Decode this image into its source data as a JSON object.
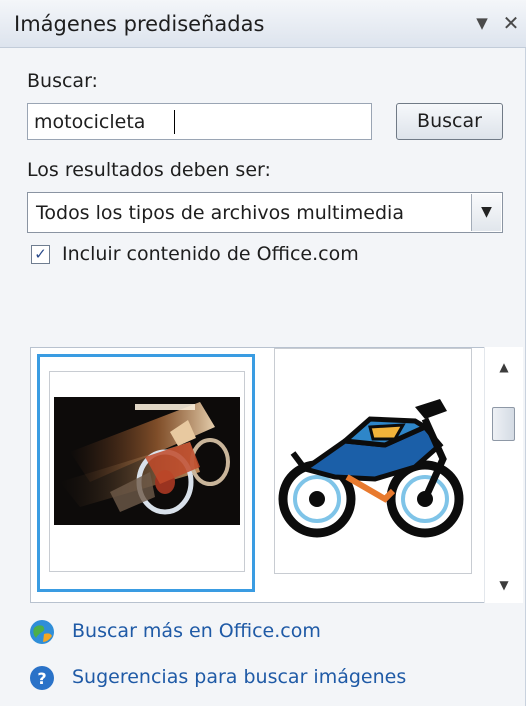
{
  "pane": {
    "title": "Imágenes prediseñadas",
    "menu_icon": "dropdown-arrow-icon",
    "close_icon": "close-icon"
  },
  "search": {
    "label": "Buscar:",
    "value": "motocicleta",
    "button_label": "Buscar"
  },
  "results_filter": {
    "label": "Los resultados deben ser:",
    "selected": "Todos los tipos de archivos multimedia"
  },
  "office_content": {
    "label": "Incluir contenido de Office.com",
    "checked": true
  },
  "results": {
    "items": [
      {
        "description": "motorcycle-photo",
        "selected": true
      },
      {
        "description": "motorcycle-clipart",
        "selected": false
      }
    ]
  },
  "links": {
    "more_online": "Buscar más en Office.com",
    "search_tips": "Sugerencias para buscar imágenes"
  },
  "colors": {
    "accent": "#3a9ce2",
    "link": "#1f5aa6",
    "pane_bg": "#f3f5f8"
  }
}
